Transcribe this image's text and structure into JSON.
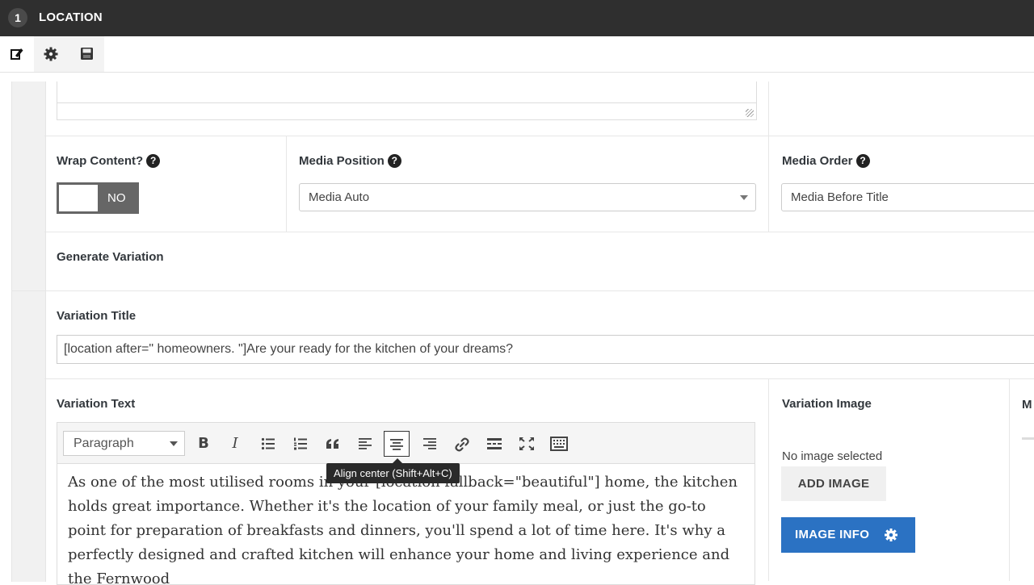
{
  "header": {
    "step_number": "1",
    "title": "LOCATION"
  },
  "tabs": [
    {
      "icon": "edit-icon"
    },
    {
      "icon": "gear-icon"
    },
    {
      "icon": "save-icon"
    }
  ],
  "fields": {
    "wrap_content": {
      "label": "Wrap Content?",
      "toggle_text": "NO"
    },
    "media_position": {
      "label": "Media Position",
      "value": "Media Auto"
    },
    "media_order": {
      "label": "Media Order",
      "value": "Media Before Title"
    },
    "generate_variation": {
      "label": "Generate Variation"
    },
    "variation_title": {
      "label": "Variation Title",
      "value": "[location after=\" homeowners. \"]Are your ready for the kitchen of your dreams?"
    },
    "variation_text": {
      "label": "Variation Text",
      "format": "Paragraph",
      "body": "As one of the most utilised rooms in your [location fallback=\"beautiful\"] home, the kitchen holds great importance. Whether it's the location of your family meal, or just the go-to point for preparation of breakfasts and dinners, you'll spend a lot of time here. It's why a perfectly designed and crafted kitchen will enhance your home and living experience and the Fernwood"
    },
    "variation_image": {
      "label": "Variation Image",
      "status": "No image selected",
      "add_button": "ADD IMAGE",
      "info_button": "IMAGE INFO"
    },
    "cut_label": "M"
  },
  "toolbar": {
    "buttons": [
      {
        "icon": "bold-icon"
      },
      {
        "icon": "italic-icon"
      },
      {
        "icon": "bullet-list-icon"
      },
      {
        "icon": "numbered-list-icon"
      },
      {
        "icon": "blockquote-icon"
      },
      {
        "icon": "align-left-icon"
      },
      {
        "icon": "align-center-icon",
        "active": true
      },
      {
        "icon": "align-right-icon"
      },
      {
        "icon": "link-icon"
      },
      {
        "icon": "read-more-icon"
      },
      {
        "icon": "fullscreen-icon"
      },
      {
        "icon": "toolbar-toggle-icon"
      }
    ],
    "tooltip": "Align center (Shift+Alt+C)"
  }
}
